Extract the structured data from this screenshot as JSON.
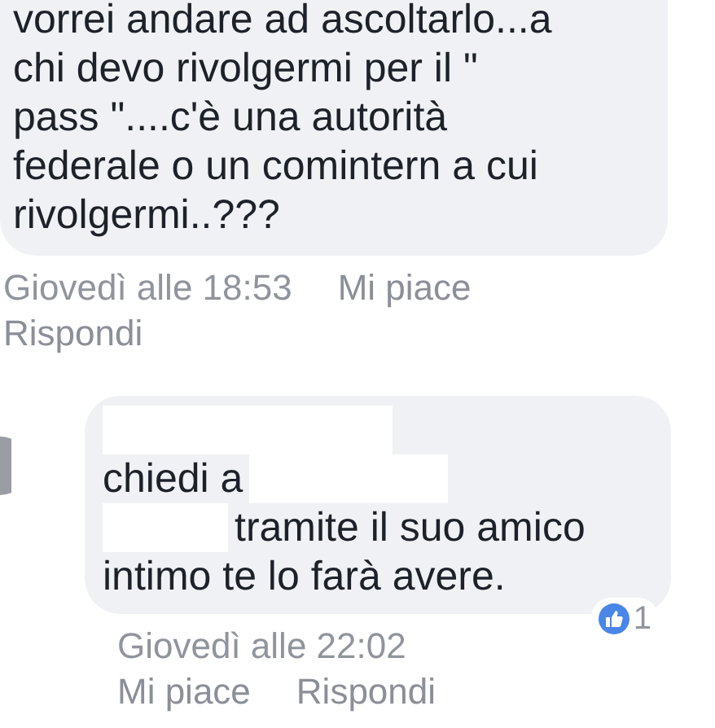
{
  "comments": [
    {
      "avatar": false,
      "lines": [
        [
          {
            "kind": "text",
            "text": "vorrei andare ad ascoltarlo...a"
          }
        ],
        [
          {
            "kind": "text",
            "text": "chi devo rivolgermi per il \""
          }
        ],
        [
          {
            "kind": "text",
            "text": "pass \"....c'è una autorità"
          }
        ],
        [
          {
            "kind": "text",
            "text": "federale o un comintern a cui"
          }
        ],
        [
          {
            "kind": "text",
            "text": "rivolgermi..???"
          }
        ]
      ],
      "time": "Giovedì alle 18:53",
      "actions": [
        "Mi piace",
        "Rispondi"
      ]
    },
    {
      "avatar": true,
      "lines": [
        [
          {
            "kind": "redacted"
          }
        ],
        [
          {
            "kind": "text",
            "text": "chiedi a"
          },
          {
            "kind": "redacted"
          }
        ],
        [
          {
            "kind": "redacted"
          },
          {
            "kind": "text",
            "text": "tramite il suo amico"
          }
        ],
        [
          {
            "kind": "text",
            "text": "intimo te lo farà avere."
          }
        ]
      ],
      "likes": {
        "count": "1"
      },
      "time": "Giovedì alle 22:02",
      "actions": [
        "Mi piace",
        "Rispondi"
      ]
    }
  ]
}
